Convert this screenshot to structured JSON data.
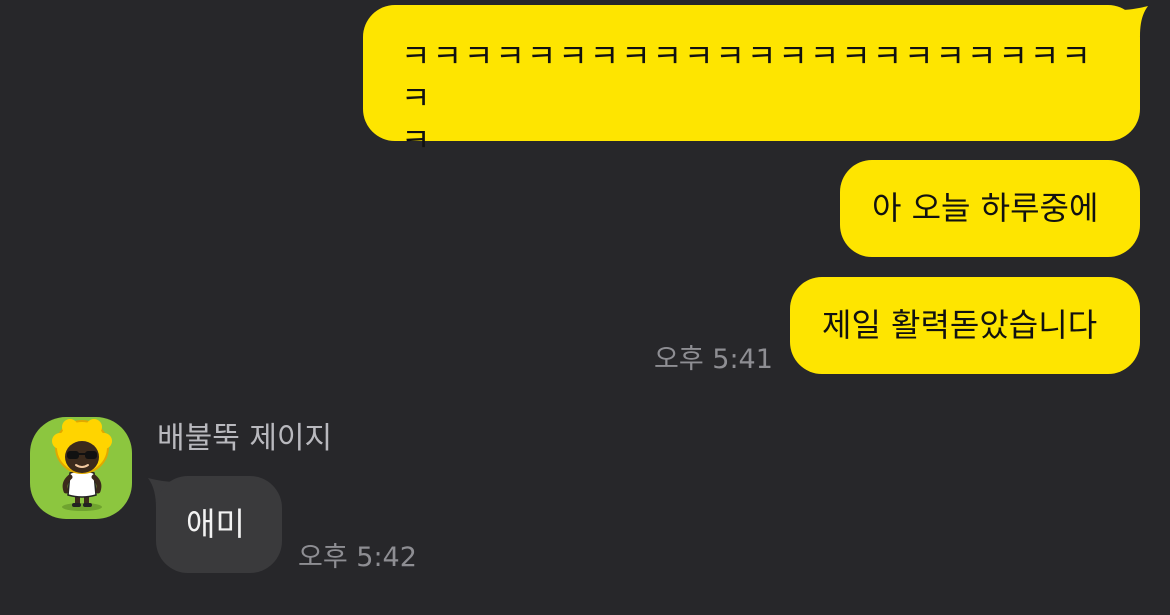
{
  "messages": {
    "sent": [
      {
        "text": "ㅋㅋㅋㅋㅋㅋㅋㅋㅋㅋㅋㅋㅋㅋㅋㅋㅋㅋㅋㅋㅋㅋㅋ\nㅋ"
      },
      {
        "text": "아 오늘 하루중에"
      },
      {
        "text": "제일 활력돋았습니다",
        "time": "오후 5:41"
      }
    ],
    "received": {
      "sender_name": "배불뚝 제이지",
      "avatar_icon": "jay-g-character-avatar",
      "text": "애미",
      "time": "오후 5:42"
    }
  },
  "colors": {
    "background": "#27272a",
    "sent_bubble": "#fee500",
    "received_bubble": "#3a3a3c",
    "time_text": "#8e8e93",
    "avatar_bg": "#8cc63f"
  }
}
